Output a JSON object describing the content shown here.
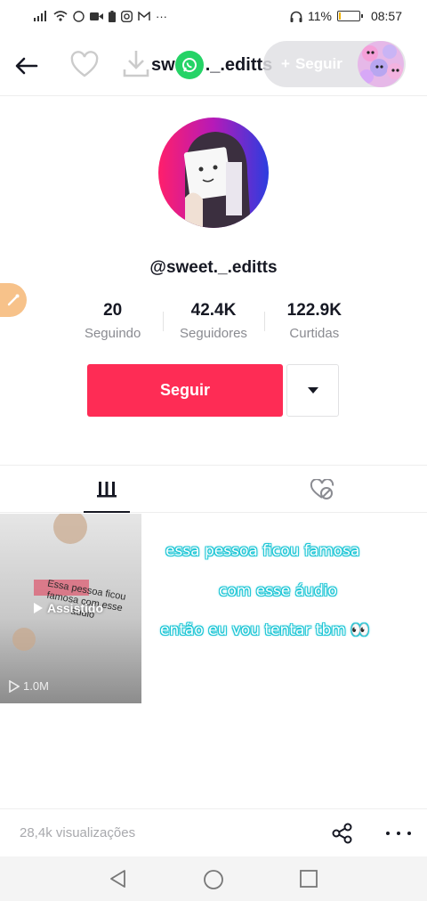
{
  "status_bar": {
    "left_icons": [
      "signal-icon",
      "wifi-icon",
      "whatsapp-icon",
      "video-icon",
      "battery-saver-icon",
      "instagram-icon",
      "gmail-icon"
    ],
    "more": "···",
    "battery_percent": "11%",
    "time": "08:57"
  },
  "header": {
    "username": "sw",
    "username_rest": "._.editts",
    "follow_label": "Seguir"
  },
  "profile": {
    "handle": "@sweet._.editts",
    "stats": [
      {
        "value": "20",
        "label": "Seguindo"
      },
      {
        "value": "42.4K",
        "label": "Seguidores"
      },
      {
        "value": "122.9K",
        "label": "Curtidas"
      }
    ],
    "follow_button": "Seguir"
  },
  "video": {
    "tile_caption": "Essa pessoa ficou famosa com esse áudio",
    "watched_label": "Assistido",
    "views": "1.0M"
  },
  "overlay_text": {
    "line1": "essa pessoa ficou famosa",
    "line2": "com esse áudio",
    "line3": "então eu vou tentar tbm 👀"
  },
  "footer": {
    "views_label": "28,4k visualizações"
  },
  "colors": {
    "accent": "#fe2c55",
    "overlay_outline": "#21c7d6"
  }
}
